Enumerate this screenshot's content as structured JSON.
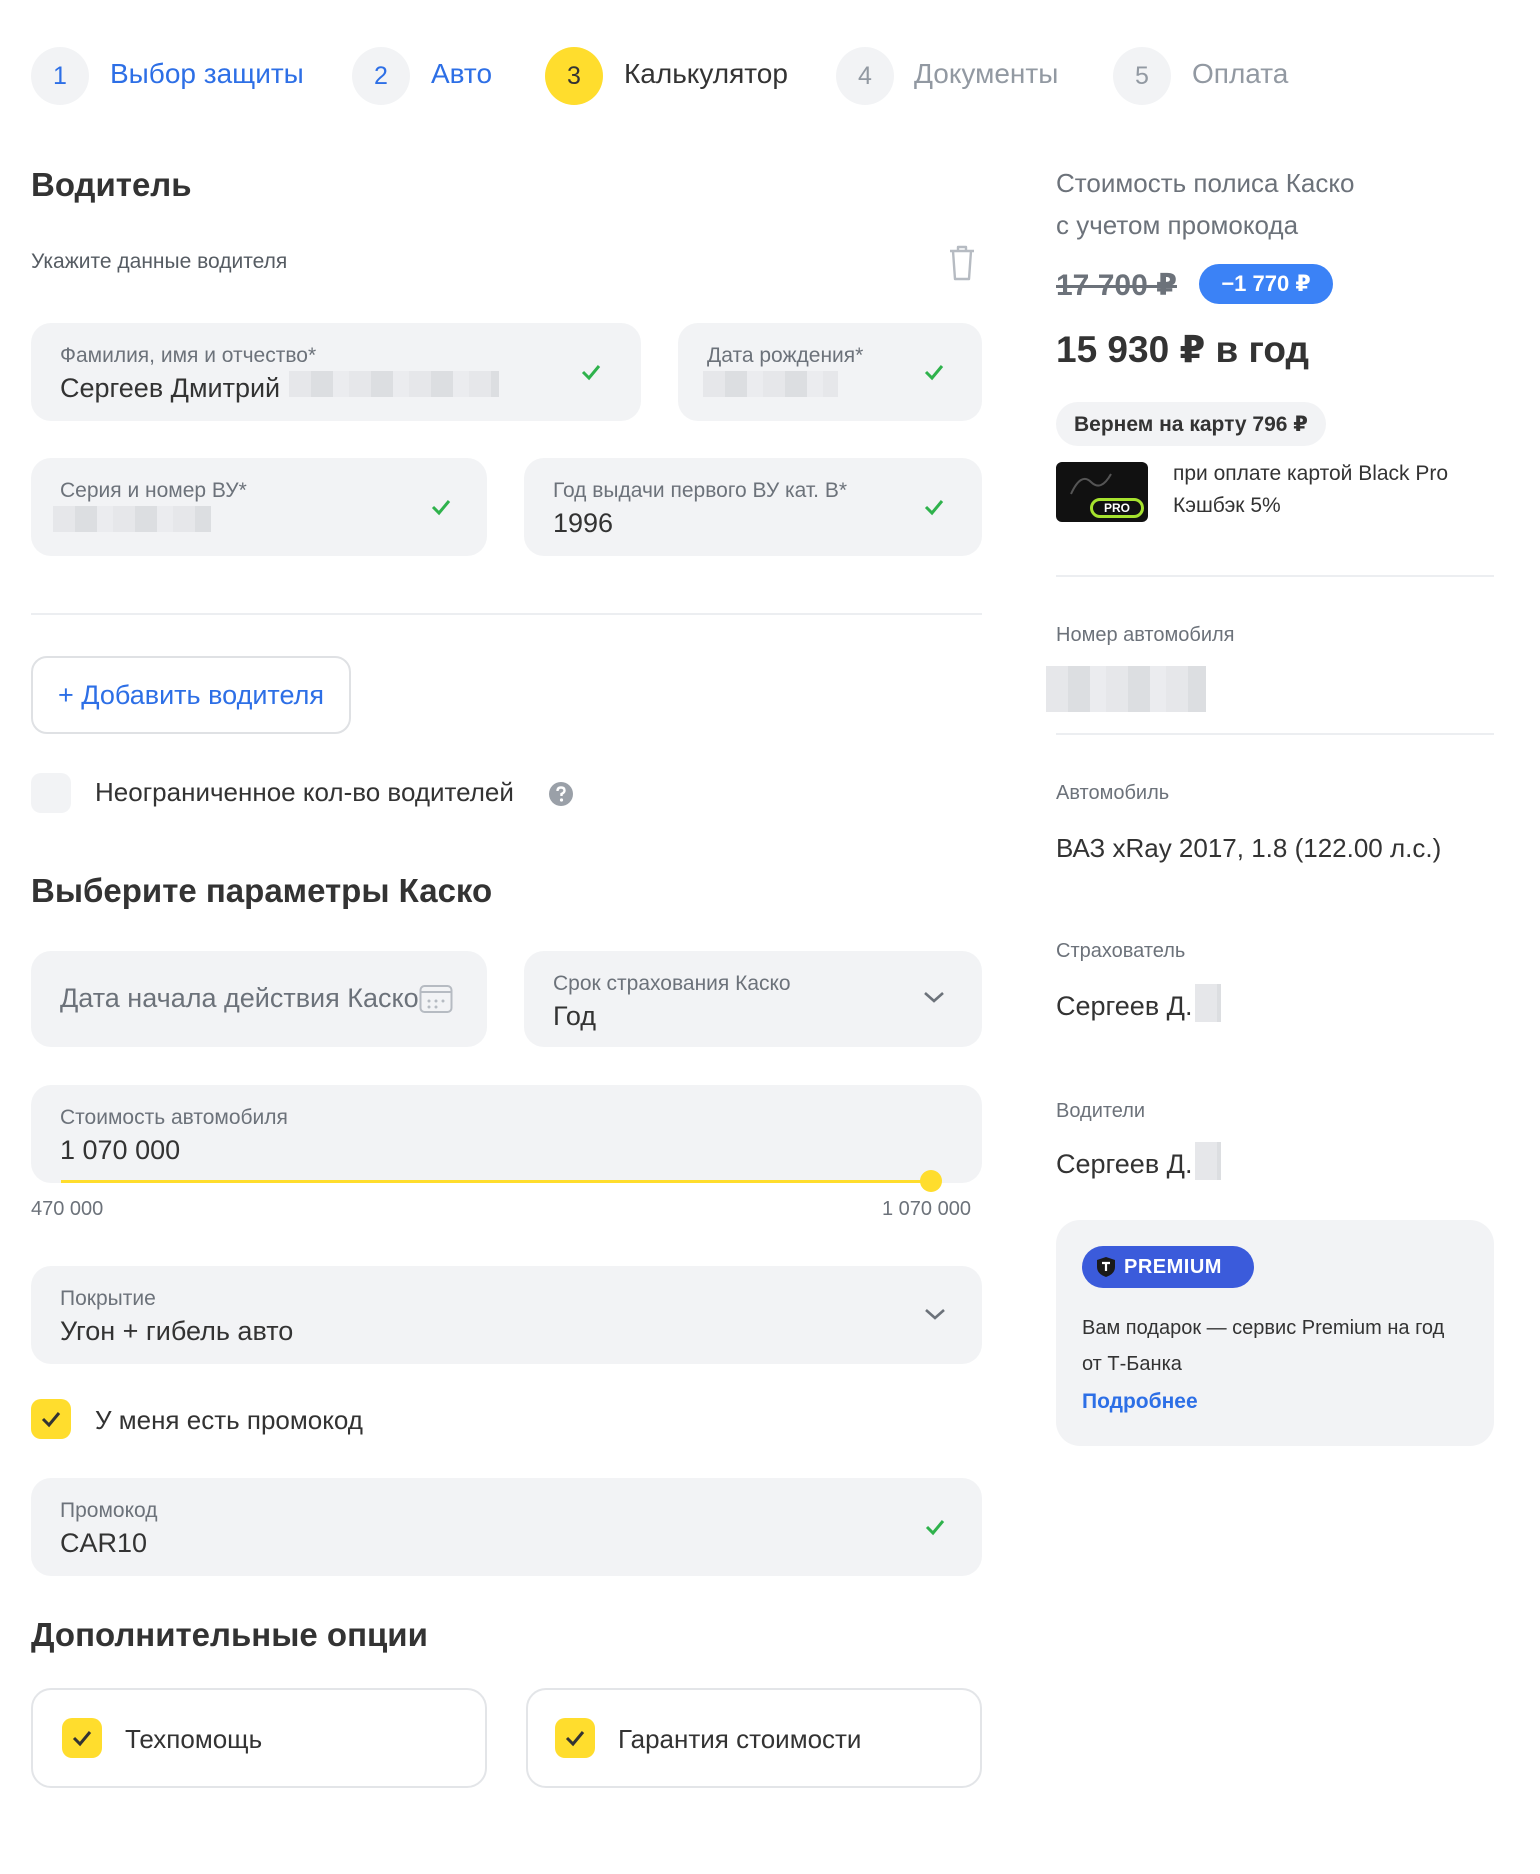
{
  "stepper": {
    "steps": [
      {
        "num": "1",
        "label": "Выбор защиты"
      },
      {
        "num": "2",
        "label": "Авто"
      },
      {
        "num": "3",
        "label": "Калькулятор"
      },
      {
        "num": "4",
        "label": "Документы"
      },
      {
        "num": "5",
        "label": "Оплата"
      }
    ]
  },
  "driver": {
    "title": "Водитель",
    "hint": "Укажите данные водителя",
    "fio_label": "Фамилия, имя и отчество*",
    "fio_value": "Сергеев Дмитрий",
    "birth_label": "Дата рождения*",
    "license_label": "Серия и номер ВУ*",
    "first_license_year_label": "Год выдачи первого ВУ кат. B*",
    "first_license_year_value": "1996",
    "add_driver_button": "+ Добавить водителя",
    "unlimited_label": "Неограниченное кол-во водителей"
  },
  "params": {
    "title": "Выберите параметры Каско",
    "start_date_placeholder": "Дата начала действия Каско",
    "term_label": "Срок страхования Каско",
    "term_value": "Год",
    "car_value_label": "Стоимость автомобиля",
    "car_value": "1 070 000",
    "range_min": "470 000",
    "range_max": "1 070 000",
    "slider_fraction": 1.0,
    "coverage_label": "Покрытие",
    "coverage_value": "Угон + гибель авто",
    "promo_checkbox_label": "У меня есть промокод",
    "promo_label": "Промокод",
    "promo_value": "CAR10"
  },
  "extras": {
    "title": "Дополнительные опции",
    "option1": "Техпомощь",
    "option2": "Гарантия стоимости"
  },
  "summary": {
    "price_title_line1": "Стоимость полиса Каско",
    "price_title_line2": "с учетом промокода",
    "old_price": "17 700 ₽",
    "discount": "−1 770 ₽",
    "price": "15 930 ₽ в год",
    "cashback": "Вернем на карту 796 ₽",
    "card_line1": "при оплате картой Black Pro",
    "card_line2": "Кэшбэк 5%",
    "card_badge": "PRO",
    "car_number_label": "Номер автомобиля",
    "car_label": "Автомобиль",
    "car_value": "ВАЗ xRay 2017, 1.8 (122.00 л.с.)",
    "insurer_label": "Страхователь",
    "insurer_value": "Сергеев Д.",
    "drivers_label": "Водители",
    "drivers_value": "Сергеев Д.",
    "premium_badge": "PREMIUM",
    "premium_text": "Вам подарок — сервис Premium на год от Т-Банка",
    "premium_link": "Подробнее"
  },
  "colors": {
    "accent_yellow": "#ffdd2d",
    "link_blue": "#2d6fe6",
    "discount_blue": "#3b82f6",
    "premium_blue": "#3b5bdb",
    "ok_green": "#2fb24c",
    "field_bg": "#f2f3f5"
  }
}
